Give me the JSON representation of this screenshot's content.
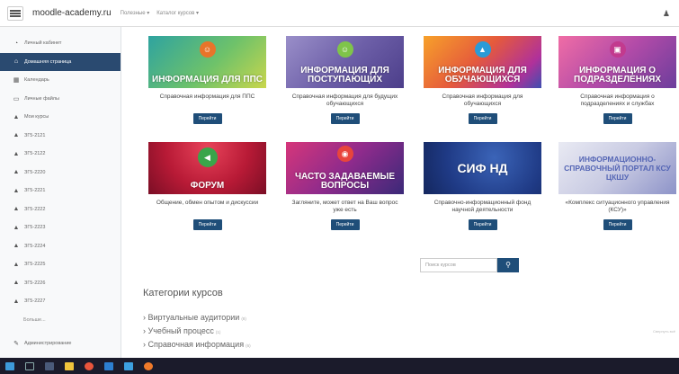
{
  "navbar": {
    "brand": "moodle-academy.ru",
    "links": [
      "Полезные ▾",
      "Каталог курсов ▾"
    ],
    "user_icon": "bell-icon"
  },
  "sidebar": {
    "items": [
      {
        "label": "Личный кабинет",
        "icon": "gauge-icon"
      },
      {
        "label": "Домашняя страница",
        "icon": "home-icon",
        "active": true
      },
      {
        "label": "Календарь",
        "icon": "calendar-icon"
      },
      {
        "label": "Личные файлы",
        "icon": "file-icon"
      },
      {
        "label": "Мои курсы",
        "icon": "graduation-cap-icon"
      }
    ],
    "courses": [
      "ЗГ5-2121",
      "ЗГ5-2122",
      "ЗГ5-2220",
      "ЗГ5-2221",
      "ЗГ5-2222",
      "ЗГ5-2223",
      "ЗГ5-2224",
      "ЗГ5-2225",
      "ЗГ5-2226",
      "ЗГ5-2227"
    ],
    "more": "Больше...",
    "admin": "Администрирование"
  },
  "cards": [
    {
      "title": "ИНФОРМАЦИЯ ДЛЯ ППС",
      "desc": "Справочная информация для ППС",
      "button": "Перейти",
      "icon": "user-icon"
    },
    {
      "title": "ИНФОРМАЦИЯ ДЛЯ ПОСТУПАЮЩИХ",
      "desc": "Справочная информация для будущих обучающихся",
      "button": "Перейти",
      "icon": "user-icon"
    },
    {
      "title": "ИНФОРМАЦИЯ ДЛЯ ОБУЧАЮЩИХСЯ",
      "desc": "Справочная информация для обучающихся",
      "button": "Перейти",
      "icon": "graduation-cap-icon"
    },
    {
      "title": "ИНФОРМАЦИЯ О ПОДРАЗДЕЛЕНИЯХ",
      "desc": "Справочная информация о подразделениях и службах",
      "button": "Перейти",
      "icon": "building-icon"
    },
    {
      "title": "ФОРУМ",
      "desc": "Общение, обмен опытом и дискуссии",
      "button": "Перейти",
      "icon": "share-icon"
    },
    {
      "title": "ЧАСТО ЗАДАВАЕМЫЕ ВОПРОСЫ",
      "desc": "Загляните, может ответ на Ваш вопрос уже есть",
      "button": "Перейти",
      "icon": "chat-icon"
    },
    {
      "title": "СИФ НД",
      "desc": "Справочно-информационный фонд научной деятельности",
      "button": "Перейти",
      "icon": ""
    },
    {
      "title": "ИНФОРМАЦИОННО-СПРАВОЧНЫЙ ПОРТАЛ КСУ ЦКШУ",
      "desc": "«Комплекс ситуационного управления (КСУ)»",
      "button": "Перейти",
      "icon": ""
    }
  ],
  "search": {
    "placeholder": "Поиск курсов",
    "button_icon": "search-icon"
  },
  "categories": {
    "heading": "Категории курсов",
    "items": [
      {
        "label": "Виртуальные аудитории",
        "count": "(8)"
      },
      {
        "label": "Учебный процесс",
        "count": "(1)"
      },
      {
        "label": "Справочная информация",
        "count": "(6)"
      }
    ],
    "footnote": "Свернуть всё"
  },
  "colors": {
    "accent": "#1f4e79",
    "sidebar_active": "#2a4a70",
    "taskbar": "#1b1b2b"
  },
  "taskbar": {
    "icons": [
      "windows-icon",
      "search-icon",
      "task-view-icon",
      "explorer-icon",
      "chrome-icon",
      "store-icon",
      "mail-icon",
      "app-icon"
    ]
  }
}
